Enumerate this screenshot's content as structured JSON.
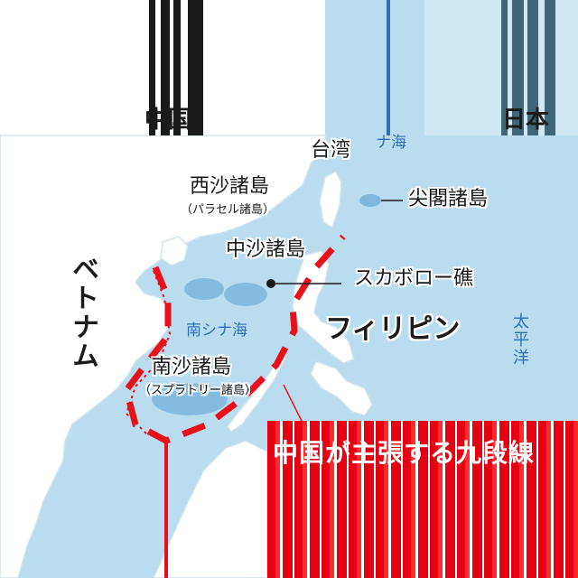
{
  "labels": {
    "china": "中国",
    "japan": "日本",
    "taiwan": "台湾",
    "senkaku": "尖閣諸島",
    "paracel": "西沙諸島",
    "paracel_sub": "（パラセル諸島）",
    "macclesfield": "中沙諸島",
    "scarborough": "スカボロー礁",
    "vietnam": "ベトナム",
    "philippines": "フィリピン",
    "spratly": "南沙諸島",
    "spratly_sub": "（スプラトリー諸島）",
    "south_china_sea": "南シナ海",
    "pacific": "太平洋",
    "sea_top": "ナ海"
  },
  "callout": {
    "title": "中国が主張する九段線"
  },
  "colors": {
    "sea": "#b9ddef",
    "land": "#ffffff",
    "border": "#cfe3ee",
    "dash_line": "#e8101a",
    "shoal": "#79b3dc",
    "accent_blue": "#2d6fb0"
  }
}
